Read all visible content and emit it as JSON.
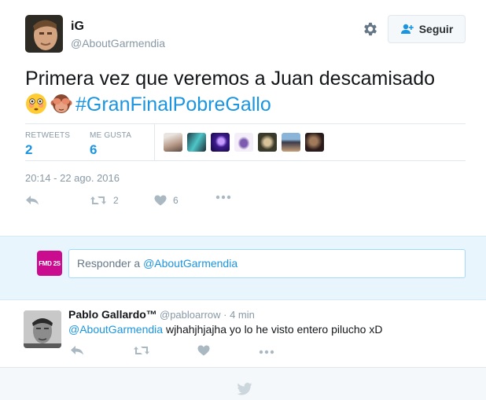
{
  "tweet": {
    "author_name": "iG",
    "author_handle": "@AboutGarmendia",
    "follow_label": "Seguir",
    "text_main": "Primera vez que veremos a Juan descamisado",
    "emojis": [
      "flushed-face",
      "see-no-evil-monkey"
    ],
    "hashtag": "#GranFinalPobreGallo",
    "retweets_label": "RETWEETS",
    "retweets_count": "2",
    "likes_label": "ME GUSTA",
    "likes_count": "6",
    "likers_count": 7,
    "timestamp": "20:14 - 22 ago. 2016",
    "actions": {
      "reply": "",
      "retweet_count": "2",
      "like_count": "6"
    }
  },
  "reply_box": {
    "avatar_text": "FMD 2S",
    "placeholder_prefix": "Responder a ",
    "placeholder_mention": "@AboutGarmendia"
  },
  "reply": {
    "author_name": "Pablo Gallardo™",
    "author_handle": "@pabloarrow",
    "time": "· 4 min",
    "mention": "@AboutGarmendia",
    "text": " wjhahjhjajha yo lo he visto entero pilucho xD"
  },
  "colors": {
    "accent": "#1b95e0",
    "muted": "#8899a6",
    "reply_bg": "#e8f5fd"
  }
}
